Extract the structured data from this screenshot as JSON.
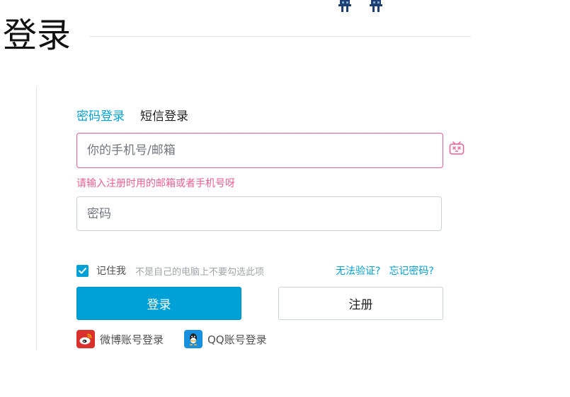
{
  "header": {
    "title": "登录"
  },
  "login": {
    "tabs": [
      {
        "label": "密码登录",
        "active": true
      },
      {
        "label": "短信登录",
        "active": false
      }
    ],
    "account_field": {
      "placeholder": "你的手机号/邮箱",
      "value": ""
    },
    "account_error": "请输入注册时用的邮箱或者手机号呀",
    "password_field": {
      "placeholder": "密码",
      "value": ""
    },
    "remember": {
      "label": "记住我",
      "checked": true,
      "hint": "不是自己的电脑上不要勾选此项"
    },
    "links": {
      "cannot_verify": "无法验证?",
      "forgot_password": "忘记密码?"
    },
    "buttons": {
      "login": "登录",
      "register": "注册"
    },
    "social": [
      {
        "label": "微博账号登录",
        "icon": "weibo-icon"
      },
      {
        "label": "QQ账号登录",
        "icon": "qq-icon"
      }
    ]
  },
  "colors": {
    "accent": "#00a1d6",
    "error": "#f25d8e",
    "border": "#ccd0d7"
  }
}
